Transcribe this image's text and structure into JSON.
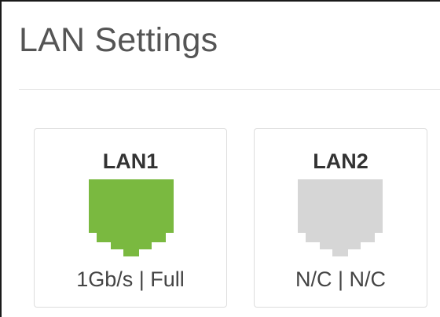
{
  "page": {
    "title": "LAN Settings"
  },
  "ports": [
    {
      "name": "LAN1",
      "status": "1Gb/s | Full",
      "connected": true,
      "icon": "ethernet-port-icon",
      "color": "#7ab940"
    },
    {
      "name": "LAN2",
      "status": "N/C | N/C",
      "connected": false,
      "icon": "ethernet-port-icon",
      "color": "#d6d6d6"
    }
  ]
}
